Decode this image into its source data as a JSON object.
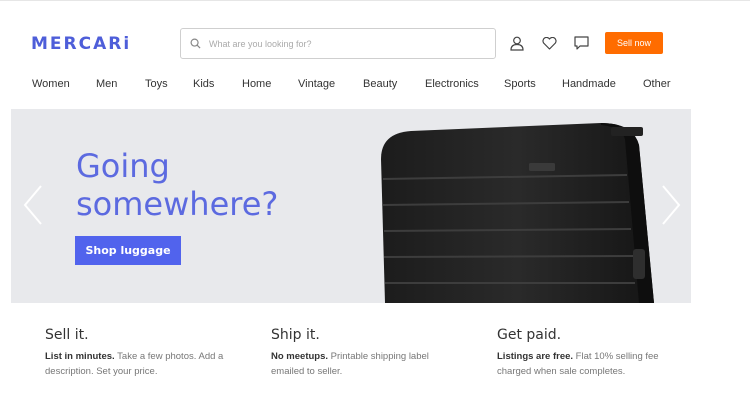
{
  "header": {
    "logo": "MERCARi",
    "search": {
      "placeholder": "What are you looking for?",
      "icon": "search-icon"
    },
    "icons": [
      "user-icon",
      "heart-icon",
      "chat-icon"
    ],
    "sell_label": "Sell now",
    "accent_color": "#ff6c00",
    "brand_color": "#4e5ed9"
  },
  "categories": [
    "Women",
    "Men",
    "Toys",
    "Kids",
    "Home",
    "Vintage",
    "Beauty",
    "Electronics",
    "Sports",
    "Handmade",
    "Other"
  ],
  "hero": {
    "title_line1": "Going",
    "title_line2": "somewhere?",
    "button_label": "Shop luggage",
    "image": "black-suitcase",
    "arrows": [
      "chevron-left-icon",
      "chevron-right-icon"
    ]
  },
  "features": [
    {
      "title": "Sell it.",
      "bold": "List in minutes.",
      "text": " Take a few photos. Add a description. Set your price."
    },
    {
      "title": "Ship it.",
      "bold": "No meetups.",
      "text": " Printable shipping label emailed to seller."
    },
    {
      "title": "Get paid.",
      "bold": "Listings are free.",
      "text": " Flat 10% selling fee charged when sale completes."
    }
  ]
}
